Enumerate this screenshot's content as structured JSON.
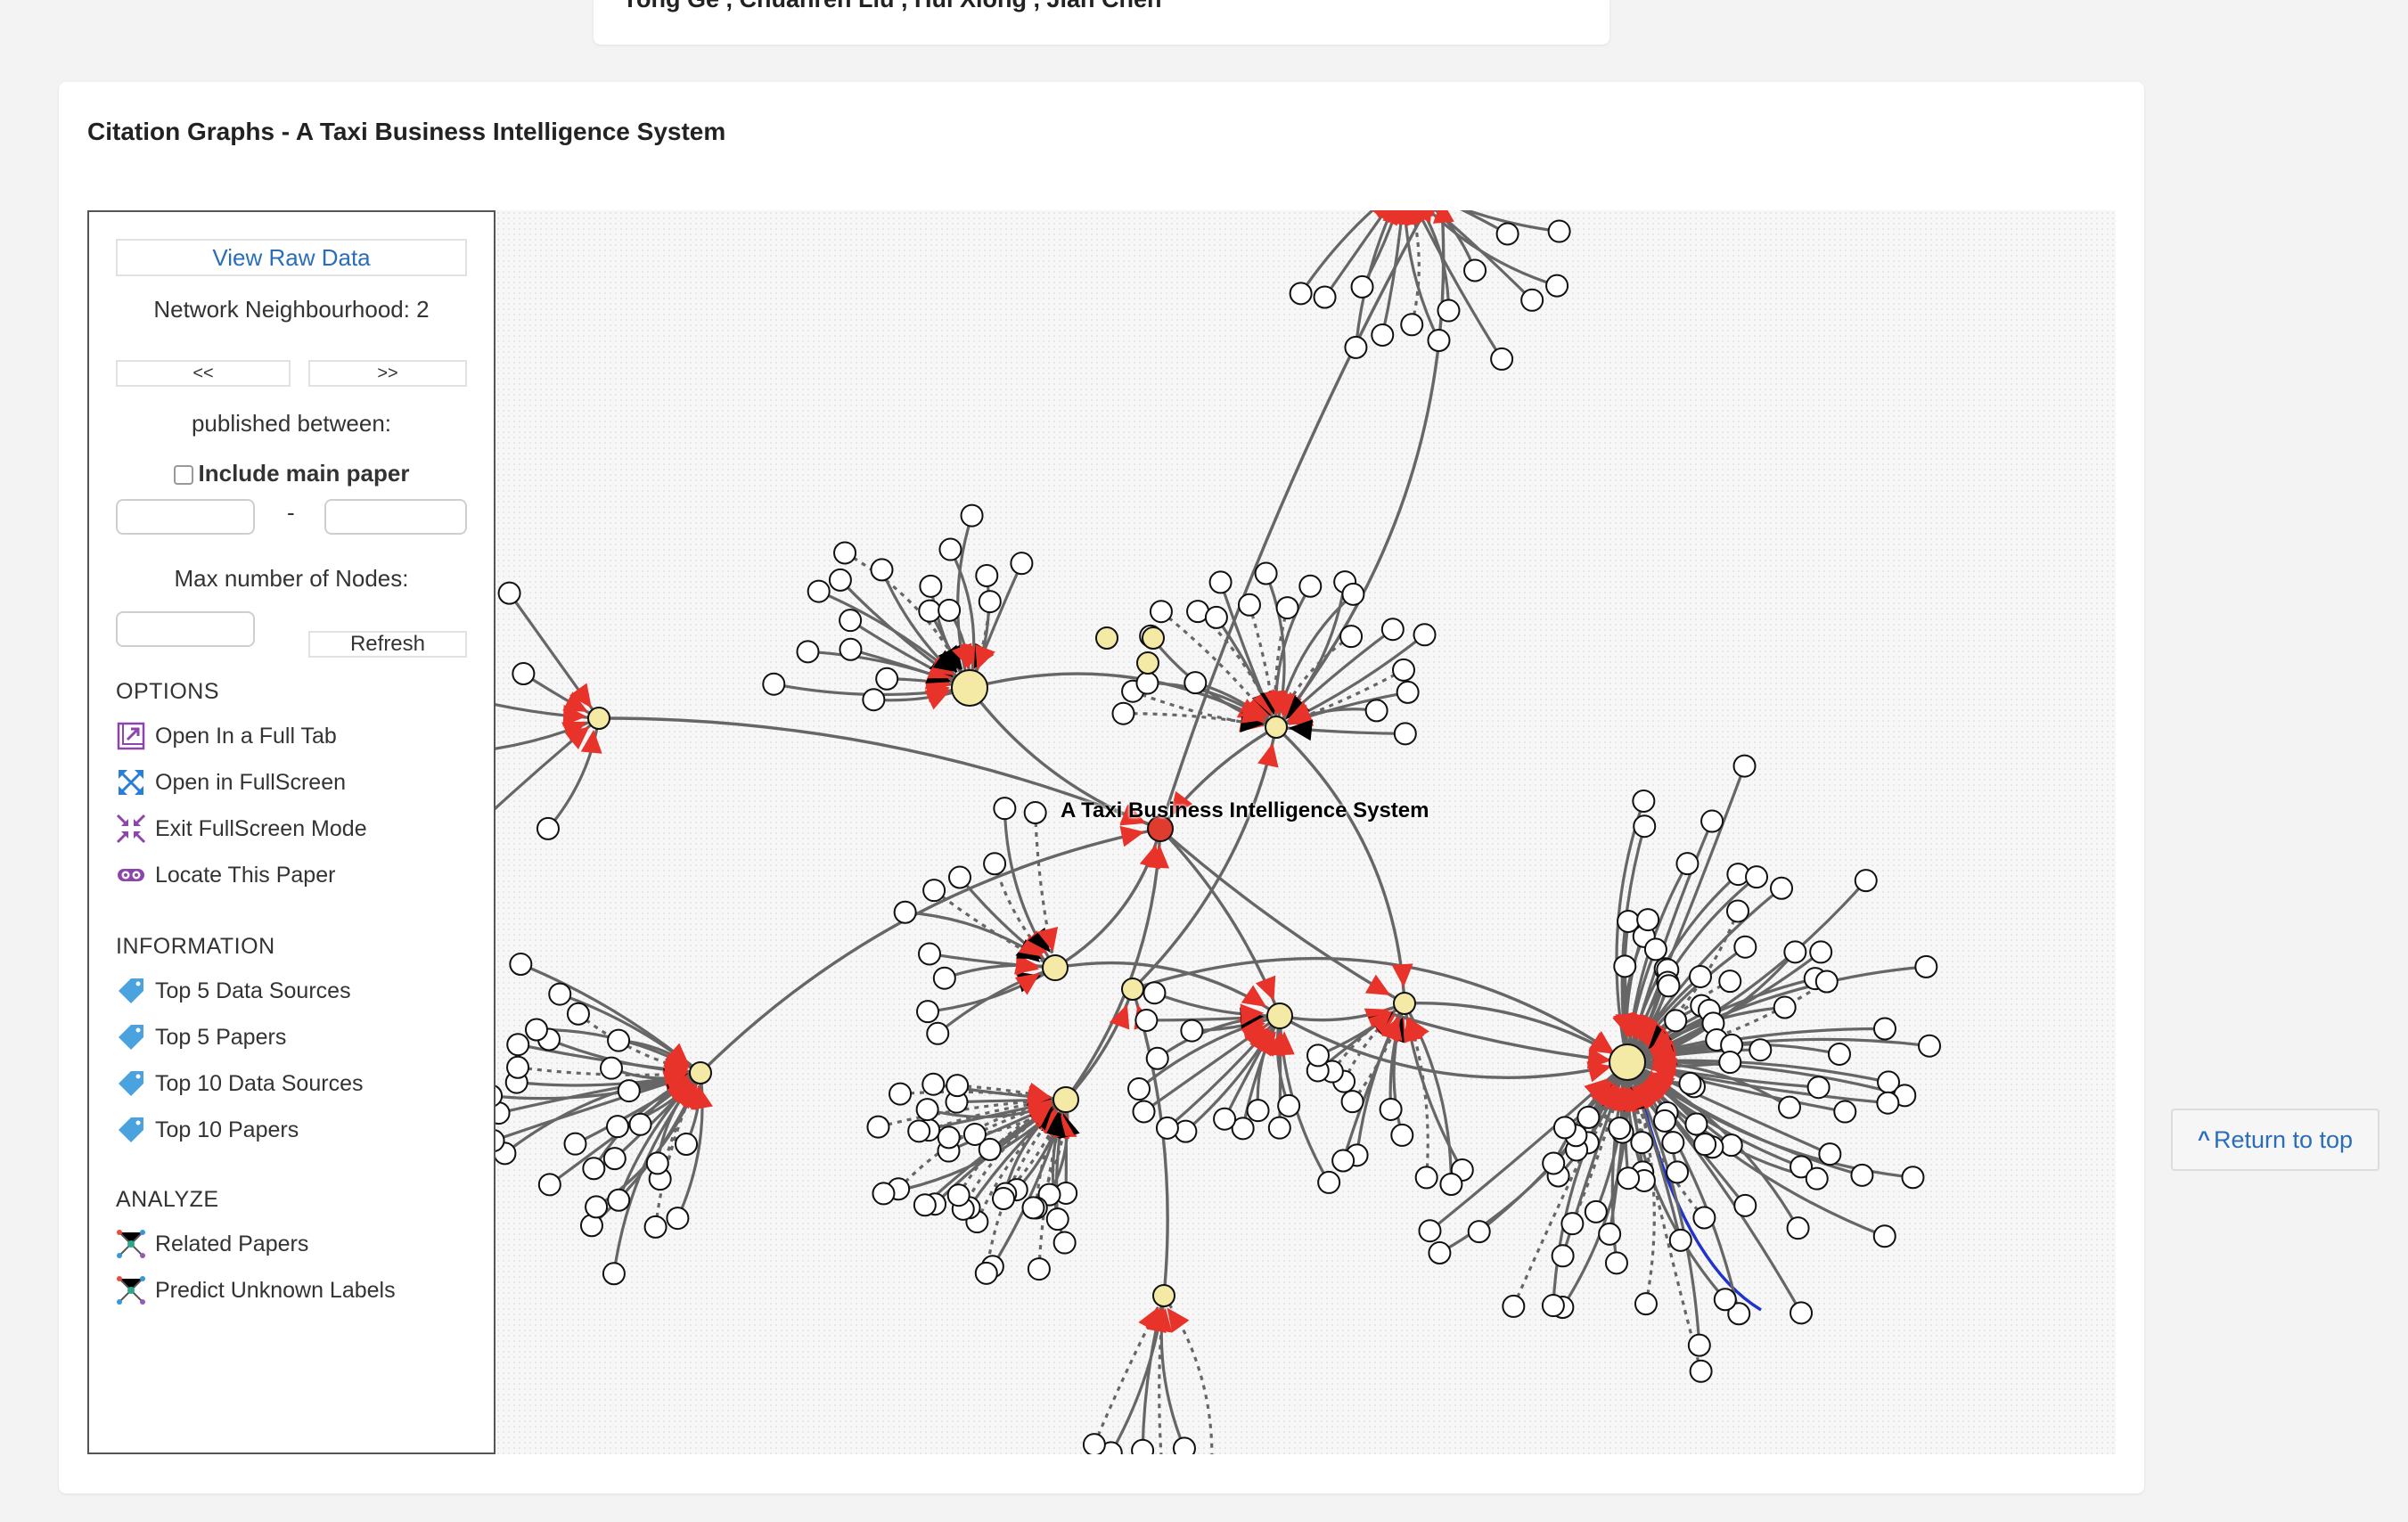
{
  "header_card": {
    "authors": "Yong Ge , Chuanren Liu , Hui Xiong , Jian Chen"
  },
  "panel": {
    "title": "Citation Graphs - A Taxi Business Intelligence System"
  },
  "sidebar": {
    "view_raw_data": "View Raw Data",
    "network_neighbourhood": "Network Neighbourhood: 2",
    "prev_label": "<<",
    "next_label": ">>",
    "published_between": "published between:",
    "include_main_paper": "Include main paper",
    "date_separator": "-",
    "date_from_value": "",
    "date_to_value": "",
    "max_nodes_label": "Max number of Nodes:",
    "max_nodes_value": "",
    "refresh_label": "Refresh",
    "options_heading": "OPTIONS",
    "options": [
      {
        "label": "Open In a Full Tab",
        "icon": "open-in-tab-icon"
      },
      {
        "label": "Open in FullScreen",
        "icon": "fullscreen-icon"
      },
      {
        "label": "Exit FullScreen Mode",
        "icon": "exit-fullscreen-icon"
      },
      {
        "label": "Locate This Paper",
        "icon": "locate-icon"
      }
    ],
    "information_heading": "INFORMATION",
    "information": [
      {
        "label": "Top 5 Data Sources",
        "icon": "tag-icon"
      },
      {
        "label": "Top 5 Papers",
        "icon": "tag-icon"
      },
      {
        "label": "Top 10 Data Sources",
        "icon": "tag-icon"
      },
      {
        "label": "Top 10 Papers",
        "icon": "tag-icon"
      }
    ],
    "analyze_heading": "ANALYZE",
    "analyze": [
      {
        "label": "Related Papers",
        "icon": "network-icon"
      },
      {
        "label": "Predict Unknown Labels",
        "icon": "network-icon"
      }
    ]
  },
  "graph": {
    "main_label": "A Taxi Business Intelligence System",
    "colors": {
      "edge": "#666666",
      "arrow_cite": "#e8332a",
      "arrow_other": "#000000",
      "highlight_edge": "#2233cc",
      "hub_fill": "#f5e9a6",
      "leaf_fill": "#ffffff",
      "main_node_fill": "#e03b2f"
    }
  },
  "return_to_top": "Return to top"
}
